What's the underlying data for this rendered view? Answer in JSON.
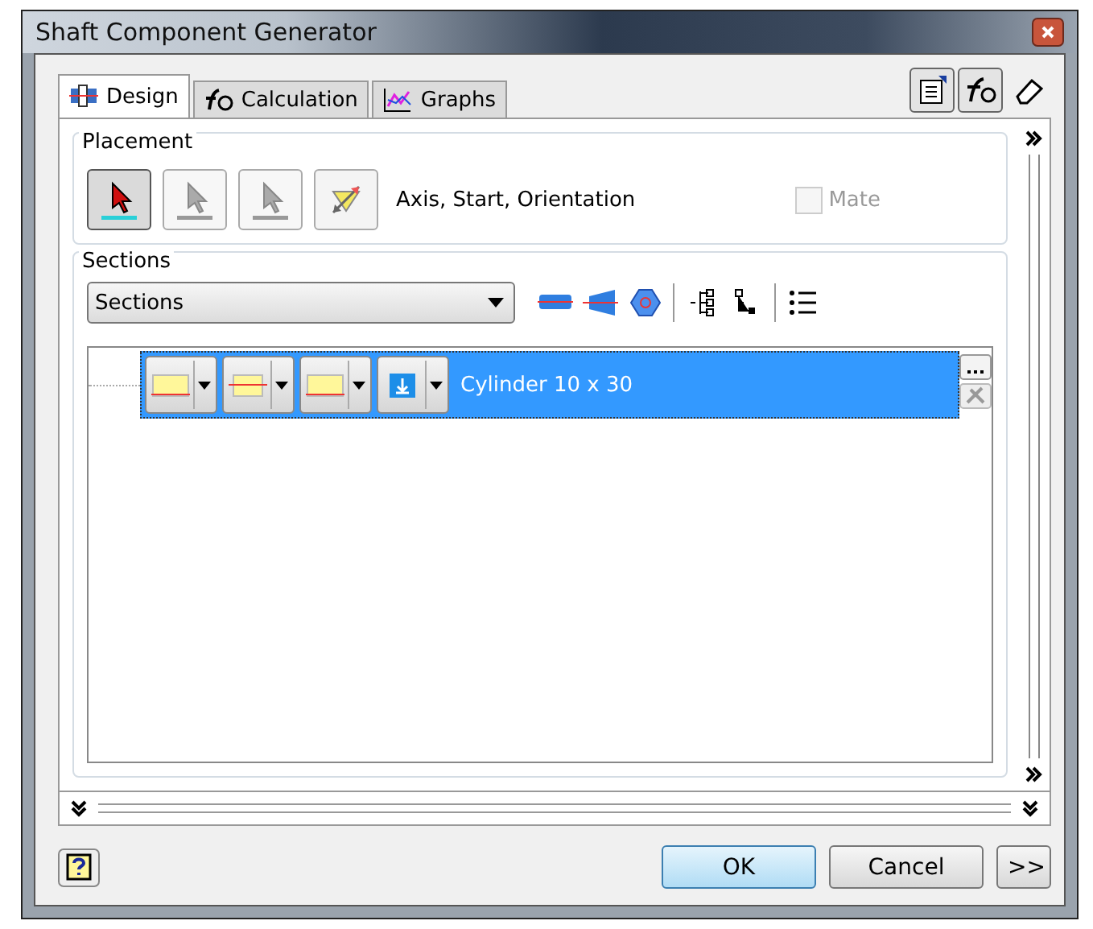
{
  "window": {
    "title": "Shaft Component Generator"
  },
  "tabs": [
    {
      "label": "Design",
      "selected": true,
      "kind": "design"
    },
    {
      "label": "Calculation",
      "selected": false,
      "kind": "calc"
    },
    {
      "label": "Graphs",
      "selected": false,
      "kind": "graphs"
    }
  ],
  "toolbar": [
    {
      "kind": "properties",
      "on": true
    },
    {
      "kind": "calc",
      "on": true
    },
    {
      "kind": "eraser",
      "on": false
    }
  ],
  "placement": {
    "label": "Placement",
    "buttons": [
      {
        "kind": "pick",
        "selected": true,
        "disabled": false
      },
      {
        "kind": "pick",
        "selected": false,
        "disabled": true
      },
      {
        "kind": "pick",
        "selected": false,
        "disabled": true
      },
      {
        "kind": "flip",
        "selected": false
      }
    ],
    "instruction": "Axis, Start, Orientation",
    "mate": {
      "label": "Mate",
      "checked": false,
      "disabled": true
    }
  },
  "sections": {
    "label": "Sections",
    "dropdown": {
      "value": "Sections"
    },
    "rows": [
      {
        "text": "Cylinder 10 x 30",
        "selected": true
      }
    ]
  },
  "buttons": [
    {
      "label": "OK",
      "default": true
    },
    {
      "label": "Cancel",
      "default": false
    },
    {
      "label": ">>",
      "default": false
    }
  ]
}
